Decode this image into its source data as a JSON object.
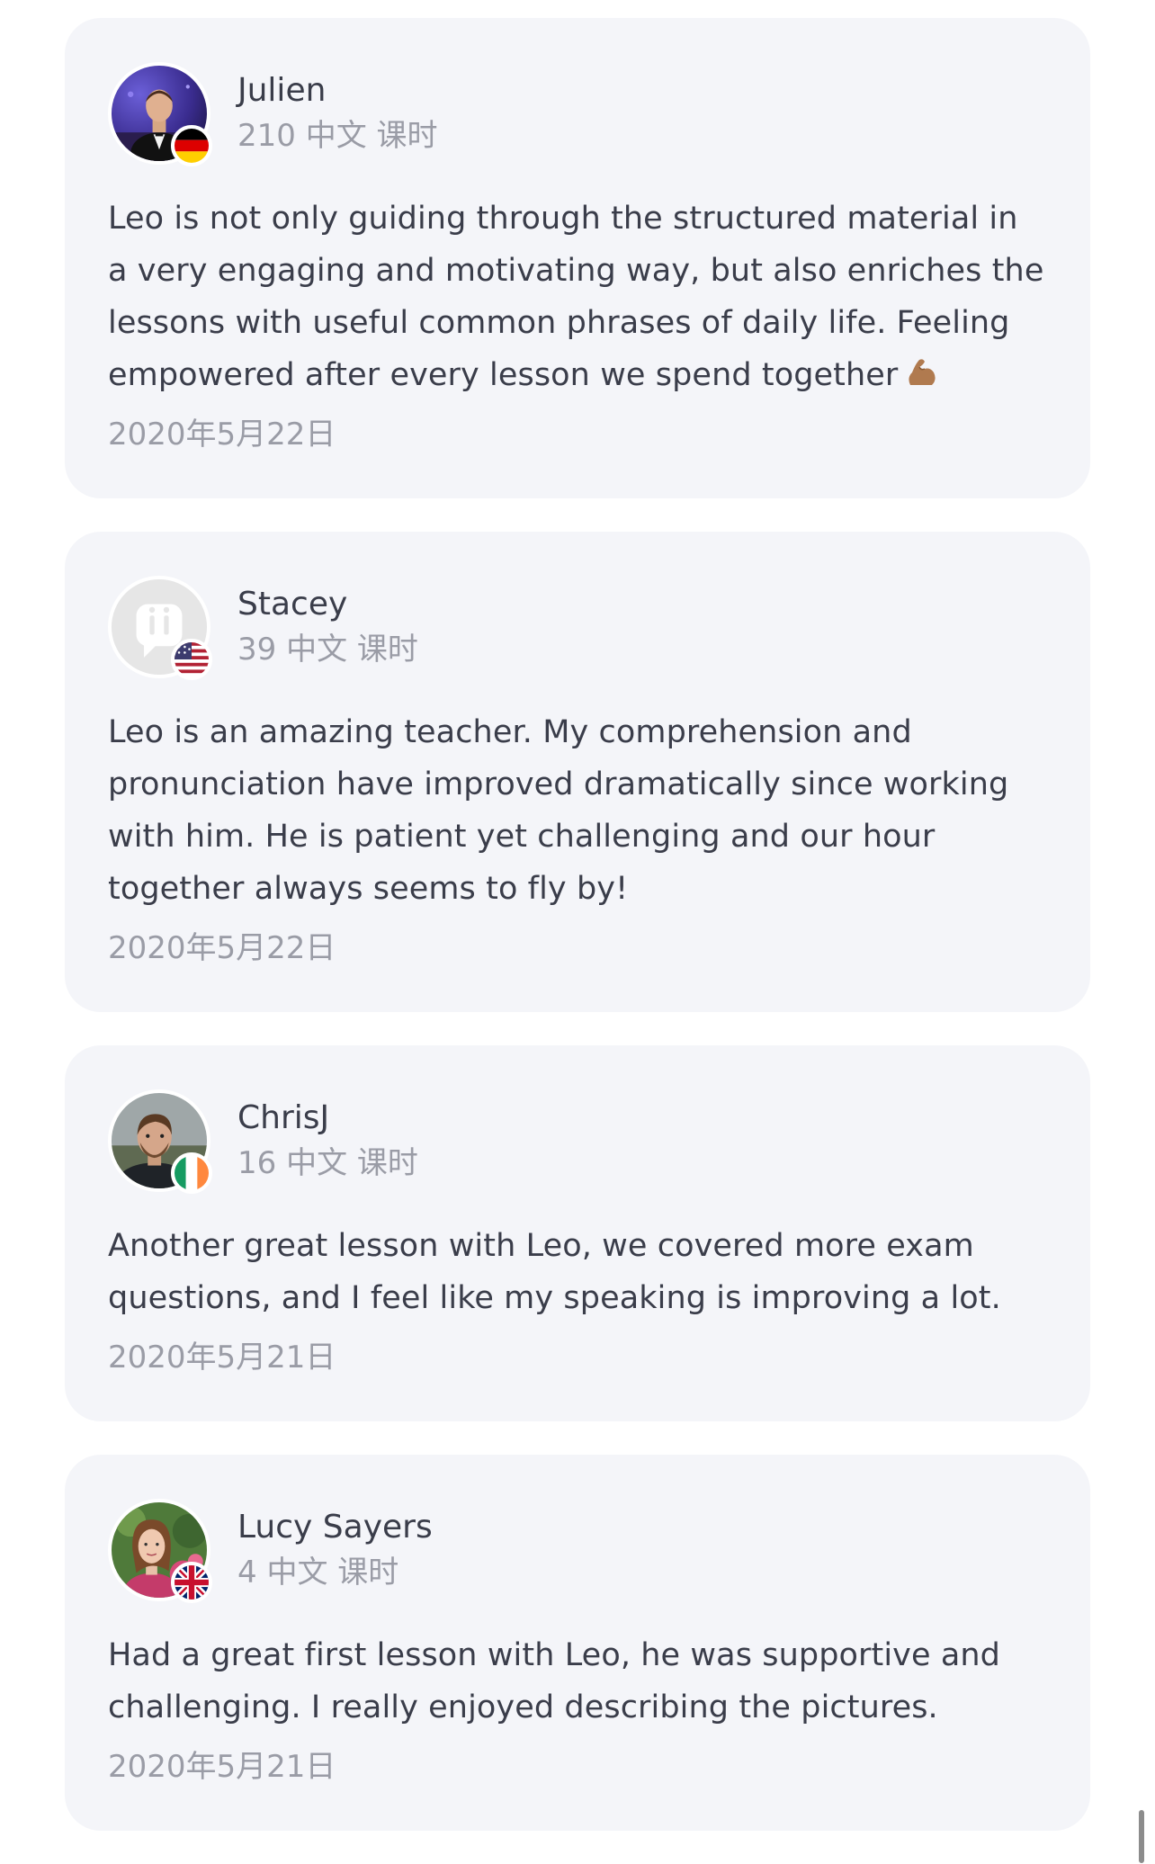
{
  "reviews": [
    {
      "name": "Julien",
      "lessons": "210 中文 课时",
      "text": "Leo is not only guiding through the structured material in a very engaging and motivating way, but also enriches the lessons with useful common phrases of daily life. Feeling empowered after every lesson we spend together",
      "date": "2020年5月22日",
      "flag": "germany-flag",
      "avatar": "photo-man-tuxedo"
    },
    {
      "name": "Stacey",
      "lessons": "39 中文 课时",
      "text": "Leo is an amazing teacher. My comprehension and pronunciation have improved dramatically since working with him. He is patient yet challenging and our hour together always seems to fly by!",
      "date": "2020年5月22日",
      "flag": "usa-flag",
      "avatar": "default-avatar-placeholder"
    },
    {
      "name": "ChrisJ",
      "lessons": "16 中文 课时",
      "text": "Another great lesson with Leo, we covered more exam questions, and I feel like my speaking is improving a lot.",
      "date": "2020年5月21日",
      "flag": "ireland-flag",
      "avatar": "photo-man-beard"
    },
    {
      "name": "Lucy Sayers",
      "lessons": "4 中文 课时",
      "text": "Had a great first lesson with Leo, he was supportive and challenging. I really enjoyed describing the pictures.",
      "date": "2020年5月21日",
      "flag": "uk-flag",
      "avatar": "photo-woman-garden"
    }
  ],
  "emoji": "flexed-biceps-icon"
}
